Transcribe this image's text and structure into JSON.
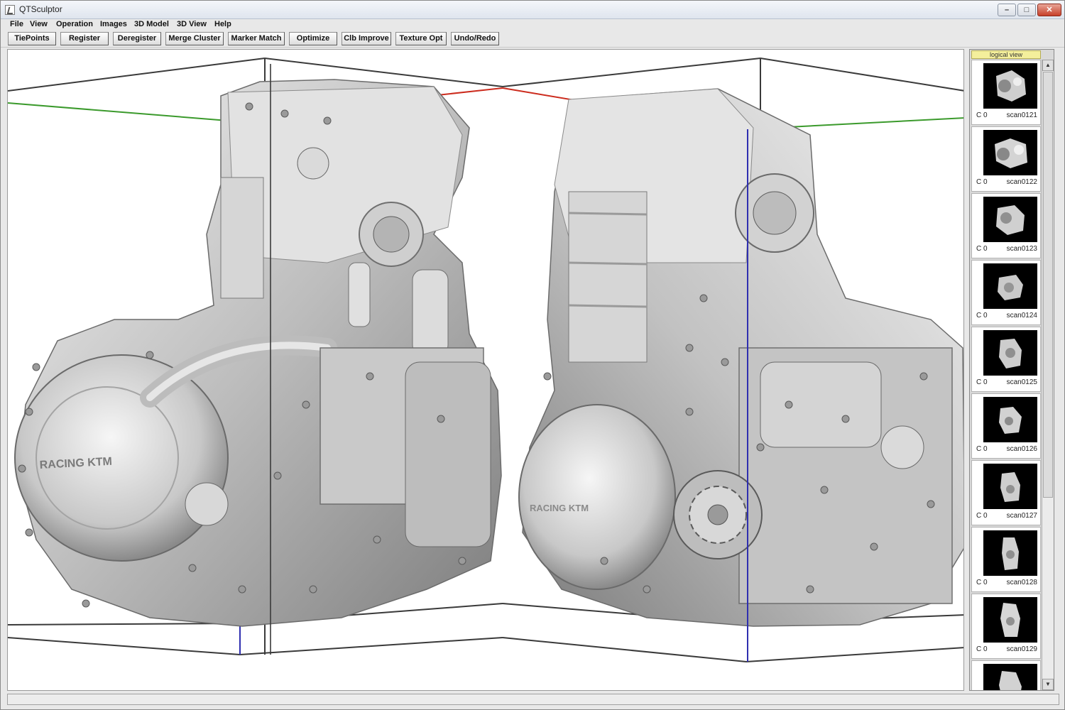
{
  "window": {
    "title": "QTSculptor",
    "controls": {
      "minimize": "–",
      "maximize": "□",
      "close": "✕"
    }
  },
  "menu": [
    "File",
    "View",
    "Operation",
    "Images",
    "3D Model",
    "3D View",
    "Help"
  ],
  "toolbar": [
    "TiePoints",
    "Register",
    "Deregister",
    "Merge Cluster",
    "Marker Match",
    "Optimize",
    "Clb Improve",
    "Texture Opt",
    "Undo/Redo"
  ],
  "viewport": {
    "axis_colors": {
      "x": "#cc2b1d",
      "y": "#3b9a2c",
      "z": "#2f2fb0",
      "box": "#3a3a3a"
    },
    "engine_logo": "RACING KTM"
  },
  "side_panel": {
    "header": "logical view",
    "scroll_up": "▲",
    "scroll_down": "▼",
    "scans": [
      {
        "c": "C 0",
        "name": "scan0121"
      },
      {
        "c": "C 0",
        "name": "scan0122"
      },
      {
        "c": "C 0",
        "name": "scan0123"
      },
      {
        "c": "C 0",
        "name": "scan0124"
      },
      {
        "c": "C 0",
        "name": "scan0125"
      },
      {
        "c": "C 0",
        "name": "scan0126"
      },
      {
        "c": "C 0",
        "name": "scan0127"
      },
      {
        "c": "C 0",
        "name": "scan0128"
      },
      {
        "c": "C 0",
        "name": "scan0129"
      },
      {
        "c": "",
        "name": ""
      }
    ]
  }
}
